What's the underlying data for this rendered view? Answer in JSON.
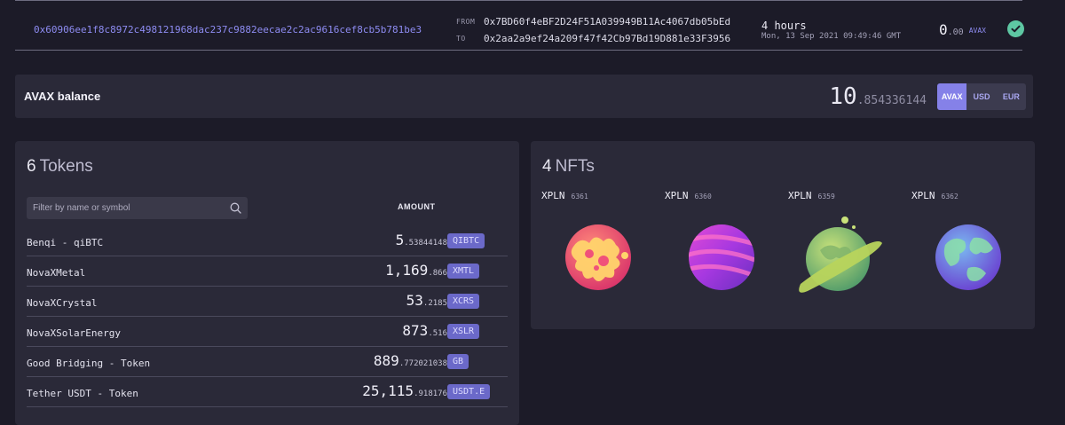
{
  "transaction": {
    "hash": "0x60906ee1f8c8972c498121968dac237c9882eecae2c2ac9616cef8cb5b781be3",
    "from_label": "FROM",
    "from_address": "0x7BD60f4eBF2D24F51A039949B11Ac4067db05bEd",
    "to_label": "TO",
    "to_address": "0x2aa2a9ef24a209f47f42Cb97Bd19D881e33F3956",
    "age": "4 hours",
    "datetime": "Mon, 13 Sep 2021 09:49:46 GMT",
    "amount_int": "0",
    "amount_dec": ".00",
    "amount_unit": "AVAX",
    "status_icon": "check-circle-icon",
    "status_color": "#5ec7a3"
  },
  "balance": {
    "title": "AVAX balance",
    "value_int": "10",
    "value_dec": ".854336144",
    "currencies": [
      "AVAX",
      "USD",
      "EUR"
    ],
    "selected_currency": "AVAX",
    "accent_color": "#8581e8"
  },
  "tokens": {
    "count": "6",
    "title": "Tokens",
    "filter_placeholder": "Filter by name or symbol",
    "filter_value": "",
    "amount_header": "AMOUNT",
    "items": [
      {
        "name": "Benqi - qiBTC",
        "amount_int": "5",
        "amount_dec": ".53844148",
        "symbol": "QIBTC"
      },
      {
        "name": "NovaXMetal",
        "amount_int": "1,169",
        "amount_dec": ".866",
        "symbol": "XMTL"
      },
      {
        "name": "NovaXCrystal",
        "amount_int": "53",
        "amount_dec": ".2185",
        "symbol": "XCRS"
      },
      {
        "name": "NovaXSolarEnergy",
        "amount_int": "873",
        "amount_dec": ".516",
        "symbol": "XSLR"
      },
      {
        "name": "Good Bridging - Token",
        "amount_int": "889",
        "amount_dec": ".772021038",
        "symbol": "GB"
      },
      {
        "name": "Tether USDT - Token",
        "amount_int": "25,115",
        "amount_dec": ".918176",
        "symbol": "USDT.E"
      }
    ]
  },
  "nfts": {
    "count": "4",
    "title": "NFTs",
    "items": [
      {
        "collection": "XPLN",
        "id": "6361",
        "image": "coral-planet-icon"
      },
      {
        "collection": "XPLN",
        "id": "6360",
        "image": "striped-planet-icon"
      },
      {
        "collection": "XPLN",
        "id": "6359",
        "image": "ringed-planet-icon"
      },
      {
        "collection": "XPLN",
        "id": "6362",
        "image": "earth-planet-icon"
      }
    ]
  }
}
